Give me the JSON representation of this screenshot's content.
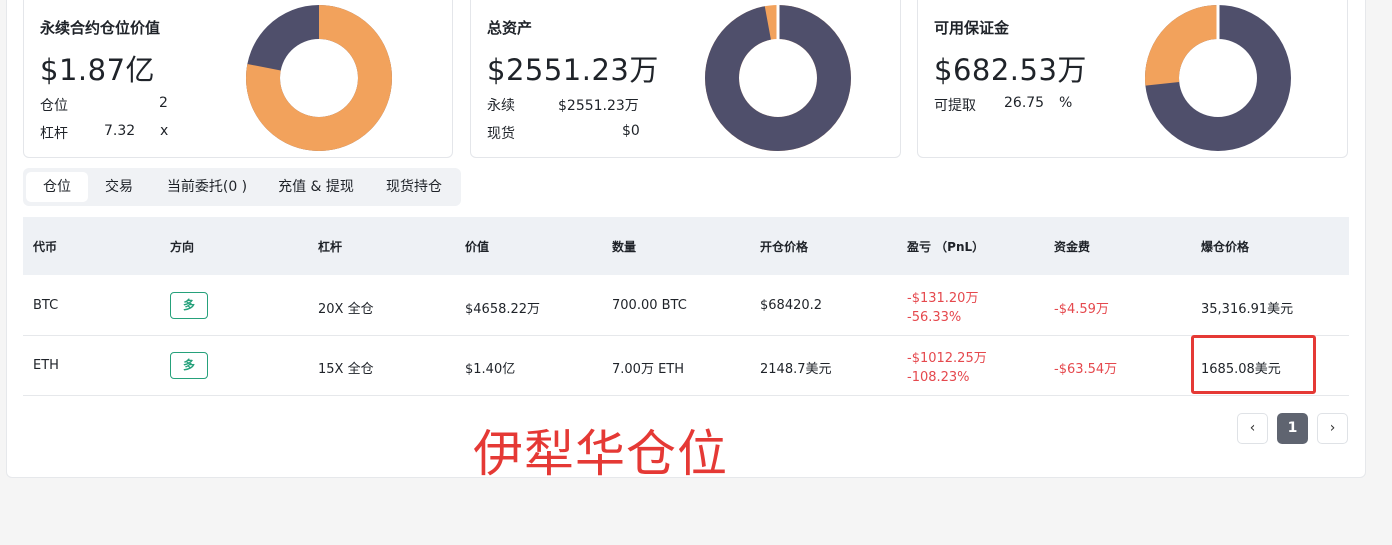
{
  "colors": {
    "navy": "#4f4f6b",
    "orange": "#f2a25c",
    "loss": "#e5484d",
    "long": "#26a17b"
  },
  "cards": [
    {
      "title": "永续合约仓位价值",
      "value": "$1.87亿",
      "rows": [
        {
          "label": "仓位",
          "value": "2",
          "unit": ""
        },
        {
          "label": "杠杆",
          "value": "7.32",
          "unit": "x"
        }
      ],
      "donut": {
        "primary_fraction": 0.78
      }
    },
    {
      "title": "总资产",
      "value": "$2551.23万",
      "rows": [
        {
          "label": "永续",
          "value": "$2551.23万"
        },
        {
          "label": "现货",
          "value": "$0"
        }
      ],
      "donut": {
        "primary_fraction": 0.97
      }
    },
    {
      "title": "可用保证金",
      "value": "$682.53万",
      "rows": [
        {
          "label": "可提取",
          "value": "26.75",
          "unit": "%"
        }
      ],
      "donut": {
        "primary_fraction": 0.2675
      }
    }
  ],
  "tabs": [
    "仓位",
    "交易",
    "当前委托(0 )",
    "充值 & 提现",
    "现货持仓"
  ],
  "table": {
    "headers": [
      "代币",
      "方向",
      "杠杆",
      "价值",
      "数量",
      "开仓价格",
      "盈亏 （PnL）",
      "资金费",
      "爆仓价格"
    ],
    "rows": [
      {
        "token": "BTC",
        "direction": "多",
        "leverage": "20X 全仓",
        "value": "$4658.22万",
        "qty": "700.00 BTC",
        "entry": "$68420.2",
        "pnl": "-$131.20万",
        "pnl_pct": "-56.33%",
        "funding": "-$4.59万",
        "liq": "35,316.91美元"
      },
      {
        "token": "ETH",
        "direction": "多",
        "leverage": "15X 全仓",
        "value": "$1.40亿",
        "qty": "7.00万 ETH",
        "entry": "2148.7美元",
        "pnl": "-$1012.25万",
        "pnl_pct": "-108.23%",
        "funding": "-$63.54万",
        "liq": "1685.08美元"
      }
    ]
  },
  "pagination": {
    "prev": "‹",
    "page": "1",
    "next": "›"
  },
  "annotation": "伊犁华仓位"
}
